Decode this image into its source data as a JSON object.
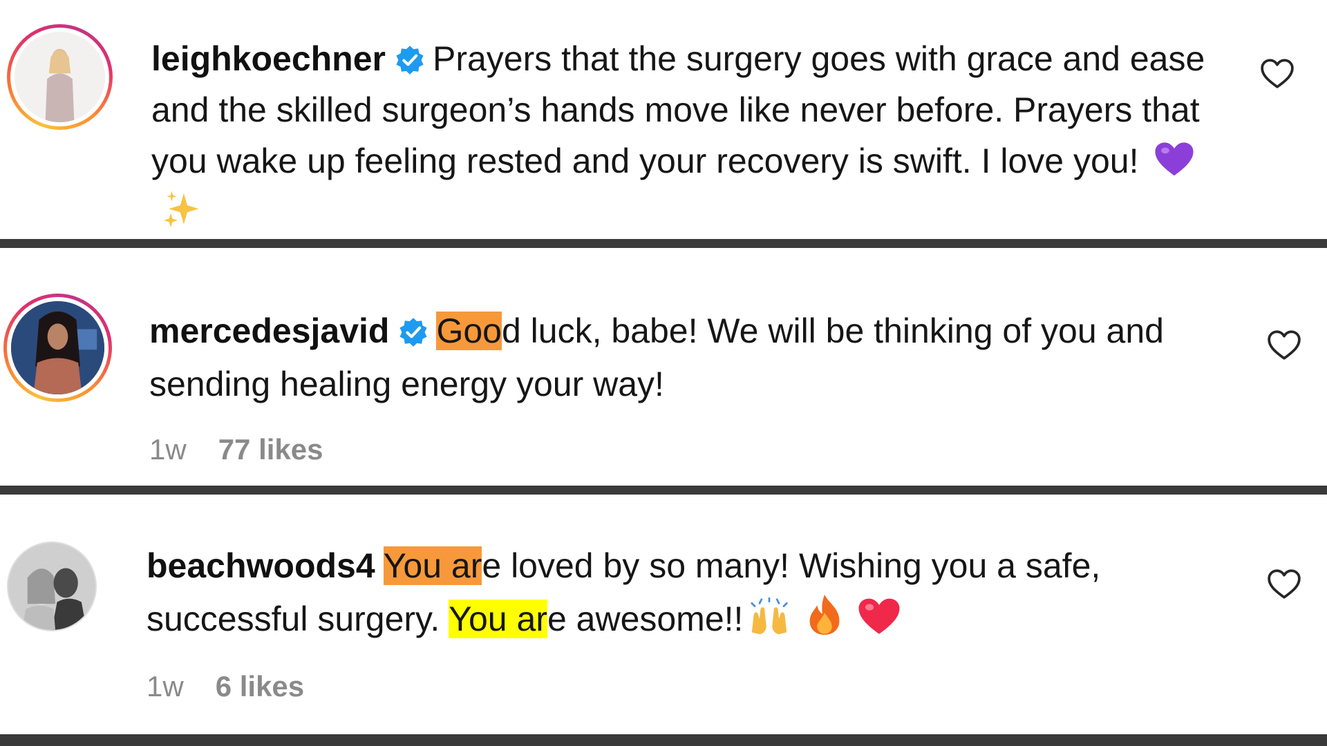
{
  "comments": [
    {
      "username": "leighkoechner",
      "verified": true,
      "text": "Prayers that the surgery goes with grace and ease and the skilled surgeon’s hands move like never before. Prayers that you wake up feeling rested and your recovery is swift. I love you!",
      "emojis": [
        "purple-heart",
        "sparkles"
      ]
    },
    {
      "username": "mercedesjavid",
      "verified": true,
      "text_highlight": "Goo",
      "text_rest": "d luck, babe! We will be thinking of you and sending healing energy your way!",
      "time": "1w",
      "likes": "77 likes"
    },
    {
      "username": "beachwoods4",
      "verified": false,
      "hl1": "You ar",
      "text_mid": "e loved by so many! Wishing you a safe, successful surgery. ",
      "hl2": "You ar",
      "text_end": "e awesome!!",
      "emojis": [
        "raising-hands",
        "fire",
        "red-heart"
      ],
      "time": "1w",
      "likes": "6 likes"
    }
  ],
  "colors": {
    "highlight_orange": "#f7993a",
    "highlight_yellow": "#ffff00",
    "verified_blue": "#1d9bf0",
    "divider": "#3a3a3a"
  }
}
